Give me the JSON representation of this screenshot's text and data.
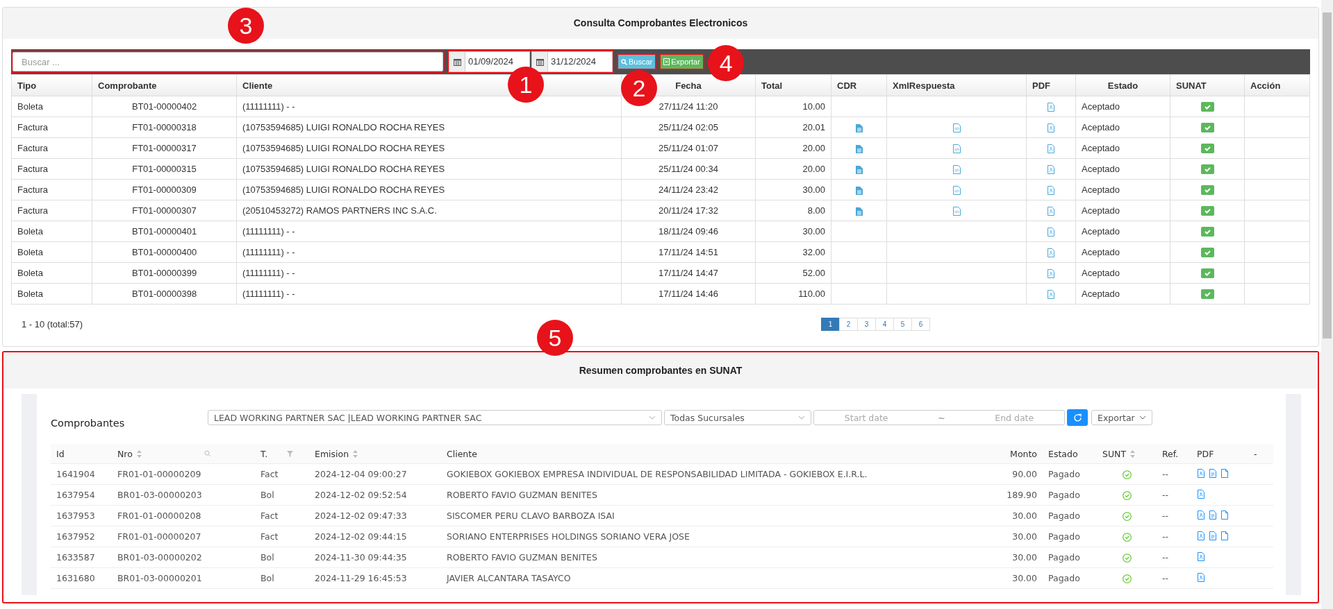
{
  "consulta": {
    "title": "Consulta Comprobantes Electronicos",
    "search": {
      "placeholder": "Buscar ...",
      "highlighted": true,
      "callout": "3"
    },
    "dates": {
      "from": "01/09/2024",
      "to": "31/12/2024",
      "highlighted": true,
      "callout": "1"
    },
    "buscar": {
      "label": "Buscar",
      "highlighted": true,
      "callout": "2"
    },
    "exportar": {
      "label": "Exportar",
      "highlighted": true,
      "callout": "4"
    },
    "columns": [
      "Tipo",
      "Comprobante",
      "Cliente",
      "Fecha",
      "Total",
      "CDR",
      "XmlRespuesta",
      "PDF",
      "Estado",
      "SUNAT",
      "Acción"
    ],
    "rows": [
      {
        "tipo": "Boleta",
        "comprobante": "BT01-00000402",
        "cliente": "(11111111) - -",
        "fecha": "27/11/24 11:20",
        "total": "10.00",
        "cdr": false,
        "xml": false,
        "pdf": true,
        "estado": "Aceptado",
        "sunat": true
      },
      {
        "tipo": "Factura",
        "comprobante": "FT01-00000318",
        "cliente": "(10753594685) LUIGI RONALDO ROCHA REYES",
        "fecha": "25/11/24 02:05",
        "total": "20.01",
        "cdr": true,
        "xml": true,
        "pdf": true,
        "estado": "Aceptado",
        "sunat": true
      },
      {
        "tipo": "Factura",
        "comprobante": "FT01-00000317",
        "cliente": "(10753594685) LUIGI RONALDO ROCHA REYES",
        "fecha": "25/11/24 01:07",
        "total": "20.00",
        "cdr": true,
        "xml": true,
        "pdf": true,
        "estado": "Aceptado",
        "sunat": true
      },
      {
        "tipo": "Factura",
        "comprobante": "FT01-00000315",
        "cliente": "(10753594685) LUIGI RONALDO ROCHA REYES",
        "fecha": "25/11/24 00:34",
        "total": "20.00",
        "cdr": true,
        "xml": true,
        "pdf": true,
        "estado": "Aceptado",
        "sunat": true
      },
      {
        "tipo": "Factura",
        "comprobante": "FT01-00000309",
        "cliente": "(10753594685) LUIGI RONALDO ROCHA REYES",
        "fecha": "24/11/24 23:42",
        "total": "30.00",
        "cdr": true,
        "xml": true,
        "pdf": true,
        "estado": "Aceptado",
        "sunat": true
      },
      {
        "tipo": "Factura",
        "comprobante": "FT01-00000307",
        "cliente": "(20510453272) RAMOS PARTNERS INC S.A.C.",
        "fecha": "20/11/24 17:32",
        "total": "8.00",
        "cdr": true,
        "xml": true,
        "pdf": true,
        "estado": "Aceptado",
        "sunat": true
      },
      {
        "tipo": "Boleta",
        "comprobante": "BT01-00000401",
        "cliente": "(11111111) - -",
        "fecha": "18/11/24 09:46",
        "total": "30.00",
        "cdr": false,
        "xml": false,
        "pdf": true,
        "estado": "Aceptado",
        "sunat": true
      },
      {
        "tipo": "Boleta",
        "comprobante": "BT01-00000400",
        "cliente": "(11111111) - -",
        "fecha": "17/11/24 14:51",
        "total": "32.00",
        "cdr": false,
        "xml": false,
        "pdf": true,
        "estado": "Aceptado",
        "sunat": true
      },
      {
        "tipo": "Boleta",
        "comprobante": "BT01-00000399",
        "cliente": "(11111111) - -",
        "fecha": "17/11/24 14:47",
        "total": "52.00",
        "cdr": false,
        "xml": false,
        "pdf": true,
        "estado": "Aceptado",
        "sunat": true
      },
      {
        "tipo": "Boleta",
        "comprobante": "BT01-00000398",
        "cliente": "(11111111) - -",
        "fecha": "17/11/24 14:46",
        "total": "110.00",
        "cdr": false,
        "xml": false,
        "pdf": true,
        "estado": "Aceptado",
        "sunat": true
      }
    ],
    "range": "1 - 10 (total:57)",
    "pages": [
      {
        "label": "1",
        "selected": true
      },
      {
        "label": "2",
        "selected": false
      },
      {
        "label": "3",
        "selected": false
      },
      {
        "label": "4",
        "selected": false
      },
      {
        "label": "5",
        "selected": false
      },
      {
        "label": "6",
        "selected": false
      }
    ]
  },
  "resumen": {
    "title": "Resumen comprobantes en SUNAT",
    "highlighted": true,
    "callout": "5",
    "heading": "Comprobantes",
    "company": "LEAD WORKING PARTNER SAC |LEAD WORKING PARTNER SAC",
    "branch": "Todas Sucursales",
    "start_placeholder": "Start date",
    "range_separator": "~",
    "end_placeholder": "End date",
    "export": "Exportar",
    "columns": [
      "Id",
      "Nro",
      "T.",
      "Emision",
      "Cliente",
      "Monto",
      "Estado",
      "SUNT",
      "Ref.",
      "PDF",
      "-"
    ],
    "rows": [
      {
        "id": "1641904",
        "nro": "FR01-01-00000209",
        "t": "Fact",
        "emision": "2024-12-04 09:00:27",
        "cliente": "GOKIEBOX GOKIEBOX EMPRESA INDIVIDUAL DE RESPONSABILIDAD LIMITADA - GOKIEBOX E.I.R.L.",
        "monto": "90.00",
        "estado": "Pagado",
        "sunat": true,
        "ref": "--",
        "files": [
          {
            "kind": "pdf"
          },
          {
            "kind": "doc"
          },
          {
            "kind": "file"
          }
        ]
      },
      {
        "id": "1637954",
        "nro": "BR01-03-00000203",
        "t": "Bol",
        "emision": "2024-12-02 09:52:54",
        "cliente": "ROBERTO FAVIO GUZMAN BENITES",
        "monto": "189.90",
        "estado": "Pagado",
        "sunat": true,
        "ref": "--",
        "files": [
          {
            "kind": "pdf"
          }
        ]
      },
      {
        "id": "1637953",
        "nro": "FR01-01-00000208",
        "t": "Fact",
        "emision": "2024-12-02 09:47:33",
        "cliente": "SISCOMER PERU CLAVO BARBOZA ISAI",
        "monto": "30.00",
        "estado": "Pagado",
        "sunat": true,
        "ref": "--",
        "files": [
          {
            "kind": "pdf"
          },
          {
            "kind": "doc"
          },
          {
            "kind": "file"
          }
        ]
      },
      {
        "id": "1637952",
        "nro": "FR01-01-00000207",
        "t": "Fact",
        "emision": "2024-12-02 09:44:15",
        "cliente": "SORIANO ENTERPRISES HOLDINGS SORIANO VERA JOSE",
        "monto": "30.00",
        "estado": "Pagado",
        "sunat": true,
        "ref": "--",
        "files": [
          {
            "kind": "pdf"
          },
          {
            "kind": "doc"
          },
          {
            "kind": "file"
          }
        ]
      },
      {
        "id": "1633587",
        "nro": "BR01-03-00000202",
        "t": "Bol",
        "emision": "2024-11-30 09:44:35",
        "cliente": "ROBERTO FAVIO GUZMAN BENITES",
        "monto": "30.00",
        "estado": "Pagado",
        "sunat": true,
        "ref": "--",
        "files": [
          {
            "kind": "pdf"
          }
        ]
      },
      {
        "id": "1631680",
        "nro": "BR01-03-00000201",
        "t": "Bol",
        "emision": "2024-11-29 16:45:53",
        "cliente": "JAVIER ALCANTARA TASAYCO",
        "monto": "30.00",
        "estado": "Pagado",
        "sunat": true,
        "ref": "--",
        "files": [
          {
            "kind": "pdf"
          }
        ]
      }
    ]
  }
}
